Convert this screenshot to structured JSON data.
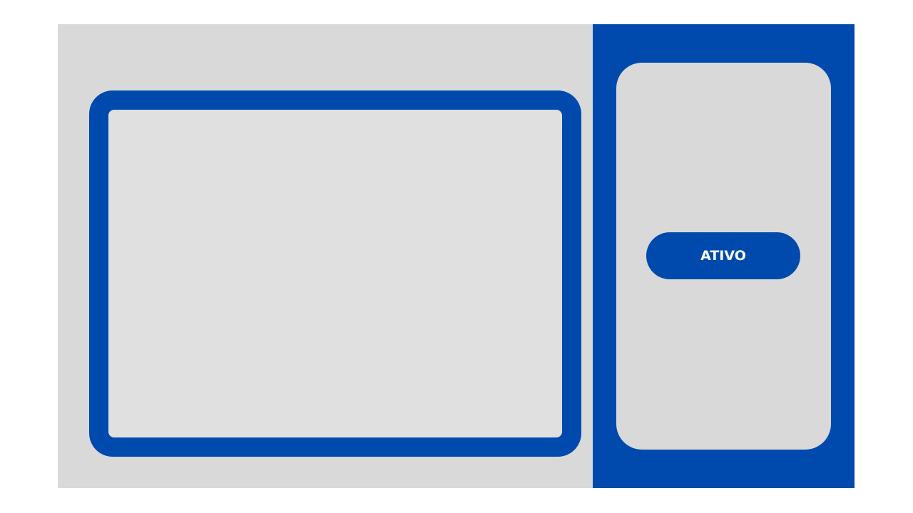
{
  "panel": {
    "status_label": "ATIVO"
  },
  "colors": {
    "accent": "#004aad",
    "surface": "#d9d9d9",
    "screen": "#e0e0e0",
    "page": "#ffffff"
  }
}
